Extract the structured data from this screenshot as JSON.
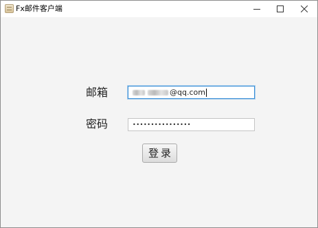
{
  "window": {
    "title": "Fx邮件客户端",
    "icon": "mail-app-icon",
    "controls": [
      "minimize",
      "maximize",
      "close"
    ]
  },
  "form": {
    "email_label": "邮箱",
    "email_value_visible": "@qq.com",
    "password_label": "密码",
    "password_mask": "••••••••••••••••",
    "login_label": "登录"
  },
  "colors": {
    "focus_border": "#3a8fd6",
    "background": "#f4f4f4",
    "titlebar": "#ffffff"
  }
}
